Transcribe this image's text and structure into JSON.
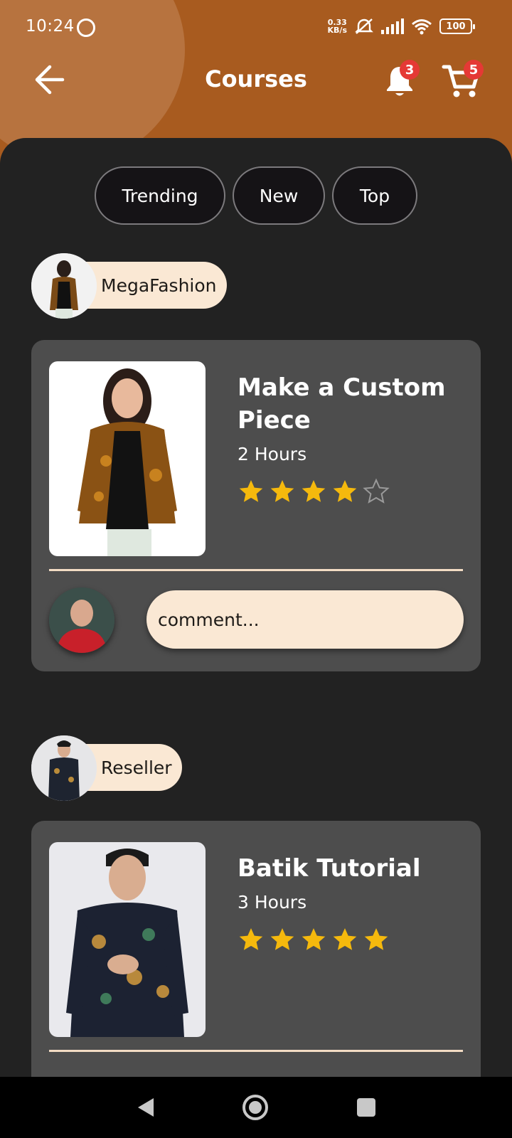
{
  "status_bar": {
    "time": "10:24",
    "net_speed_value": "0.33",
    "net_speed_unit": "KB/s",
    "battery": "100"
  },
  "header": {
    "title": "Courses",
    "notification_count": "3",
    "cart_count": "5",
    "background_color": "#a85b1f"
  },
  "tabs": [
    {
      "label": "Trending"
    },
    {
      "label": "New"
    },
    {
      "label": "Top"
    }
  ],
  "posts": [
    {
      "author": "MegaFashion",
      "course": {
        "title": "Make a Custom Piece",
        "duration": "2 Hours",
        "rating": 4,
        "rating_max": 5
      },
      "comment_placeholder": "comment..."
    },
    {
      "author": "Reseller",
      "course": {
        "title": "Batik Tutorial",
        "duration": "3 Hours",
        "rating": 5,
        "rating_max": 5
      }
    }
  ],
  "colors": {
    "star": "#f5b90d",
    "accent_pill": "#fae8d4",
    "card": "#4d4d4d"
  }
}
